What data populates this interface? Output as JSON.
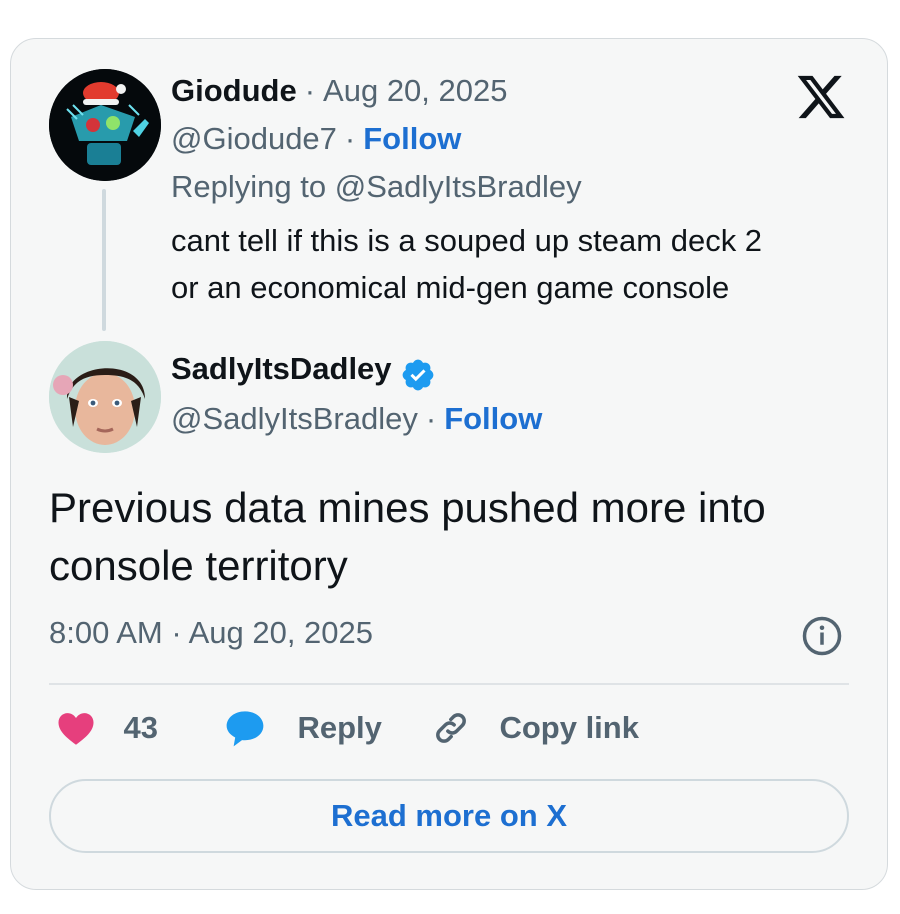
{
  "reply_tweet": {
    "display_name": "Giodude",
    "date": "Aug 20, 2025",
    "handle": "@Giodude7",
    "follow_label": "Follow",
    "replying_prefix": "Replying to ",
    "replying_to": "@SadlyItsBradley",
    "text_line1": "cant tell if this is a souped up steam deck 2",
    "text_line2": "or an economical mid-gen game console"
  },
  "main_tweet": {
    "display_name": "SadlyItsDadley",
    "handle": "@SadlyItsBradley",
    "follow_label": "Follow",
    "text_line1": "Previous data mines pushed more into",
    "text_line2": "console territory",
    "timestamp": "8:00 AM · Aug 20, 2025"
  },
  "actions": {
    "likes": "43",
    "reply_label": "Reply",
    "copy_link_label": "Copy link"
  },
  "read_more_label": "Read more on X",
  "separator": "·",
  "icons": [
    "x-logo-icon",
    "verified-badge-icon",
    "info-icon",
    "heart-icon",
    "reply-bubble-icon",
    "link-icon"
  ],
  "colors": {
    "link": "#1d6fd1",
    "heart": "#e63f7d",
    "reply_bubble": "#1d9bf0",
    "verified": "#1d9bf0",
    "muted": "#536471",
    "card_bg": "#f6f7f7"
  }
}
